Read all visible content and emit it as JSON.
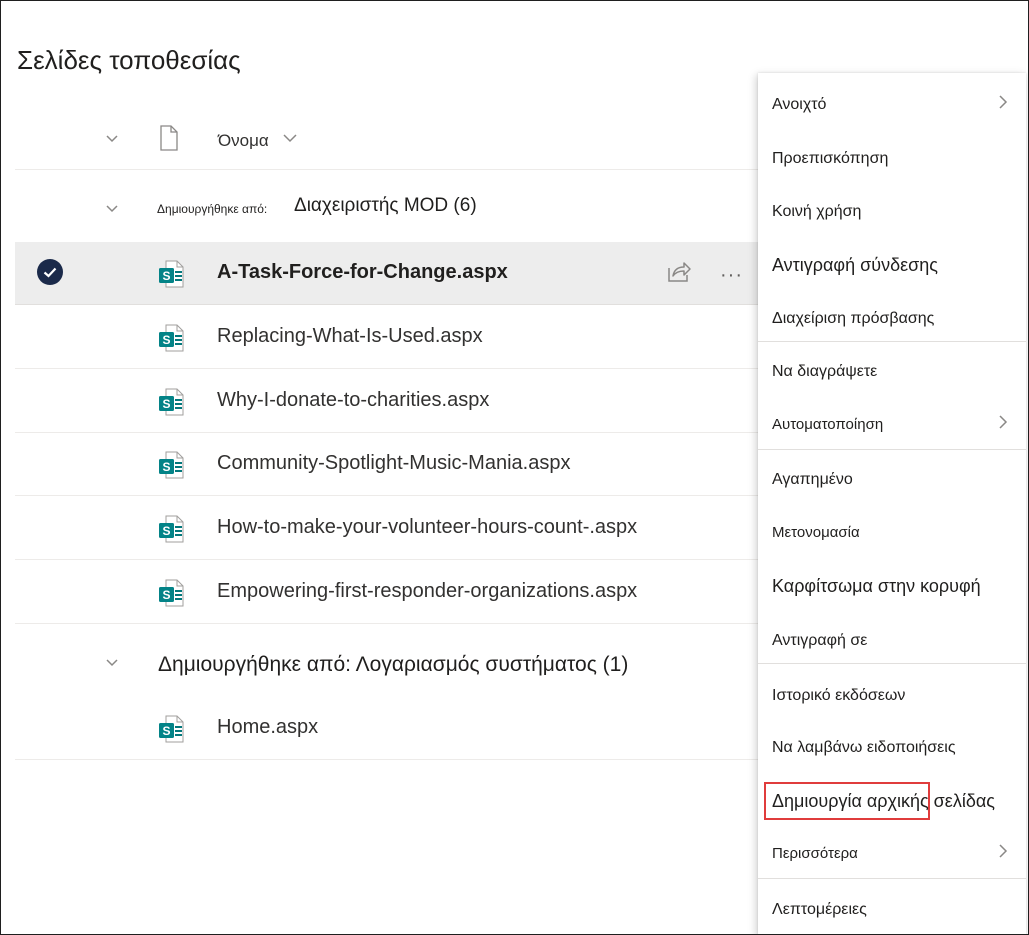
{
  "page": {
    "title": "Σελίδες τοποθεσίας"
  },
  "columns": {
    "name": "Όνομα"
  },
  "groups": [
    {
      "label_prefix": "Δημιουργήθηκε από:",
      "label_value": "Διαχειριστής MOD (6)"
    },
    {
      "label_full": "Δημιουργήθηκε από: Λογαριασμός συστήματος (1)"
    }
  ],
  "files": [
    {
      "name": "A-Task-Force-for-Change.aspx",
      "selected": true
    },
    {
      "name": "Replacing-What-Is-Used.aspx"
    },
    {
      "name": "Why-I-donate-to-charities.aspx"
    },
    {
      "name": "Community-Spotlight-Music-Mania.aspx"
    },
    {
      "name": "How-to-make-your-volunteer-hours-count-.aspx"
    },
    {
      "name": "Empowering-first-responder-organizations.aspx"
    },
    {
      "name": "Home.aspx"
    }
  ],
  "row_actions": {
    "more": "···"
  },
  "context_menu": {
    "items": [
      {
        "label": "Ανοιχτό",
        "submenu": true
      },
      {
        "label": "Προεπισκόπηση"
      },
      {
        "label": "Κοινή χρήση"
      },
      {
        "label": "Αντιγραφή σύνδεσης"
      },
      {
        "label": "Διαχείριση πρόσβασης"
      },
      {
        "label": "Να διαγράψετε"
      },
      {
        "label": "Αυτοματοποίηση",
        "submenu": true
      },
      {
        "label": "Αγαπημένο"
      },
      {
        "label": "Μετονομασία"
      },
      {
        "label": "Καρφίτσωμα στην κορυφή"
      },
      {
        "label": "Αντιγραφή σε"
      },
      {
        "label": "Ιστορικό εκδόσεων"
      },
      {
        "label": "Να λαμβάνω ειδοποιήσεις"
      },
      {
        "label": "Δημιουργία αρχικής σελίδας",
        "highlighted": true
      },
      {
        "label": "Περισσότερα",
        "submenu": true
      },
      {
        "label": "Λεπτομέρειες"
      }
    ]
  },
  "colors": {
    "sharepoint_green": "#038387",
    "highlight_red": "#e03c3c",
    "check_navy": "#1b2a4a"
  }
}
